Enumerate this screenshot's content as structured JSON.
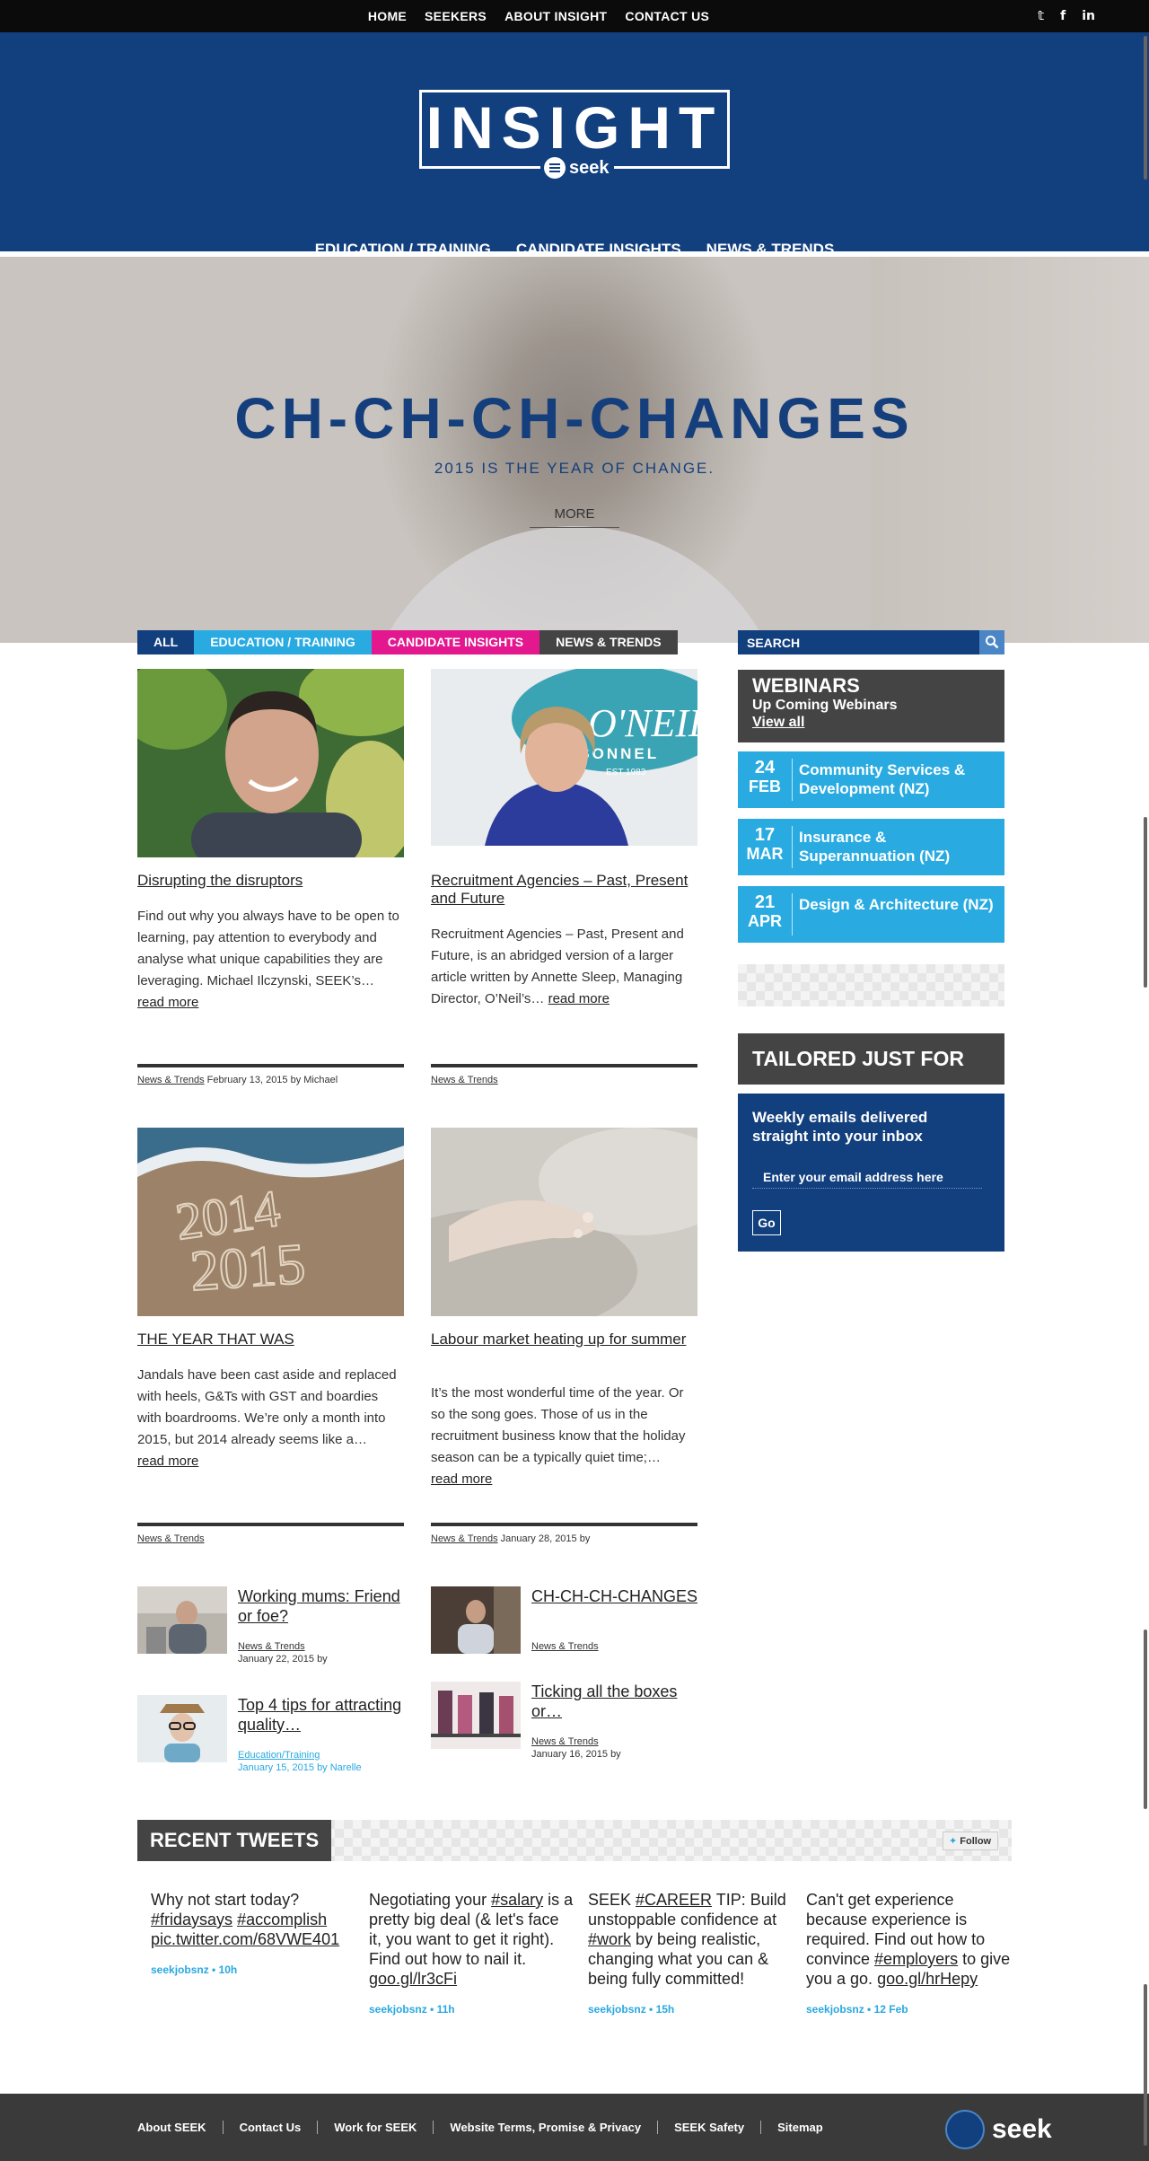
{
  "top_nav": [
    "HOME",
    "SEEKERS",
    "ABOUT INSIGHT",
    "CONTACT US"
  ],
  "social": [
    "twitter-icon",
    "facebook-icon",
    "linkedin-icon"
  ],
  "social_glyphs": [
    "𝕥",
    "f",
    "in"
  ],
  "logo": {
    "title": "INSIGHT",
    "brand": "seek"
  },
  "main_nav": [
    "EDUCATION / TRAINING",
    "CANDIDATE INSIGHTS",
    "NEWS & TRENDS"
  ],
  "hero": {
    "title": "CH-CH-CH-CHANGES",
    "subtitle": "2015 IS THE YEAR OF CHANGE.",
    "more": "MORE"
  },
  "filter_tabs": [
    {
      "label": "ALL",
      "color": "#123f7d"
    },
    {
      "label": "EDUCATION / TRAINING",
      "color": "#29abe2"
    },
    {
      "label": "CANDIDATE INSIGHTS",
      "color": "#e3178e"
    },
    {
      "label": "NEWS & TRENDS",
      "color": "#444444"
    }
  ],
  "search": {
    "placeholder": "SEARCH"
  },
  "articles": [
    {
      "title": "Disrupting the disruptors",
      "excerpt": "Find out why you always have to be open to learning, pay attention to everybody and analyse what unique capabilities they are leveraging. Michael Ilczynski, SEEK’s…",
      "read_more": "read more",
      "category": "News & Trends",
      "meta": " February 13, 2015 by Michael"
    },
    {
      "title": "Recruitment Agencies – Past, Present and Future",
      "excerpt": "Recruitment Agencies – Past, Present and Future, is an abridged version of a larger article written by Annette Sleep, Managing Director, O’Neil’s…",
      "read_more": "read more",
      "category": "News & Trends",
      "meta": ""
    },
    {
      "title": "THE YEAR THAT WAS",
      "excerpt": "Jandals have been cast aside and replaced with heels, G&Ts with GST and boardies with boardrooms. We’re only a month into 2015, but 2014 already seems like a…",
      "read_more": "read more",
      "category": "News & Trends",
      "meta": ""
    },
    {
      "title": "Labour market heating up for summer",
      "excerpt": "It’s the most wonderful time of the year. Or so the song goes. Those of us in the recruitment business know that the holiday season can be a typically quiet time;…",
      "read_more": "read more",
      "category": "News & Trends",
      "meta": " January 28, 2015 by"
    }
  ],
  "oneils_sign": {
    "line1": "O'NEILS",
    "line2": "RSONNEL",
    "line3": "EST 1983"
  },
  "sand_text": {
    "line1": "2014",
    "line2": "2015"
  },
  "mini_posts": [
    {
      "title": "Working mums: Friend or foe?",
      "category": "News & Trends",
      "date": "January 22, 2015 by"
    },
    {
      "title": "CH-CH-CH-CHANGES",
      "category": "News & Trends",
      "date": ""
    },
    {
      "title": "Top 4 tips for attracting quality…",
      "category": "Education/Training",
      "date": "January 15, 2015 by Narelle"
    },
    {
      "title": "Ticking all the boxes or…",
      "category": "News & Trends",
      "date": "January 16, 2015 by"
    }
  ],
  "webinars": {
    "heading": "WEBINARS",
    "subheading": "Up Coming Webinars",
    "view_all": "View all",
    "items": [
      {
        "day": "24",
        "month": "FEB",
        "name": "Community Services & Development (NZ)"
      },
      {
        "day": "17",
        "month": "MAR",
        "name": "Insurance & Superannuation (NZ)"
      },
      {
        "day": "21",
        "month": "APR",
        "name": "Design & Architecture (NZ)"
      }
    ]
  },
  "tailored": {
    "heading": "TAILORED JUST FOR YOU",
    "text": "Weekly emails delivered straight into your inbox",
    "placeholder": "Enter your email address here",
    "button": "Go"
  },
  "tweets": {
    "heading": "RECENT TWEETS",
    "follow": "Follow",
    "items": [
      {
        "parts": [
          {
            "t": "Why not start today? "
          },
          {
            "t": "#fridaysays",
            "link": true
          },
          {
            "t": " "
          },
          {
            "t": "#accomplish",
            "link": true
          },
          {
            "t": " "
          },
          {
            "t": "pic.twitter.com/68VWE401",
            "link": true
          }
        ],
        "handle": "seekjobsnz",
        "time": "10h"
      },
      {
        "parts": [
          {
            "t": "Negotiating your "
          },
          {
            "t": "#salary",
            "link": true
          },
          {
            "t": " is a pretty big deal (& let's face it, you want to get it right). Find out how to nail it. "
          },
          {
            "t": "goo.gl/lr3cFi",
            "link": true
          }
        ],
        "handle": "seekjobsnz",
        "time": "11h"
      },
      {
        "parts": [
          {
            "t": "SEEK "
          },
          {
            "t": "#CAREER",
            "link": true
          },
          {
            "t": " TIP: Build unstoppable confidence at "
          },
          {
            "t": "#work",
            "link": true
          },
          {
            "t": " by being realistic, changing what you can & being fully committed!"
          }
        ],
        "handle": "seekjobsnz",
        "time": "15h"
      },
      {
        "parts": [
          {
            "t": "Can't get experience because experience is required. Find out how to convince "
          },
          {
            "t": "#employers",
            "link": true
          },
          {
            "t": " to give you a go. "
          },
          {
            "t": "goo.gl/hrHepy",
            "link": true
          }
        ],
        "handle": "seekjobsnz",
        "time": "12 Feb"
      }
    ]
  },
  "footer": {
    "links": [
      "About SEEK",
      "Contact Us",
      "Work for SEEK",
      "Website Terms, Promise & Privacy",
      "SEEK Safety",
      "Sitemap"
    ],
    "brand": "seek"
  }
}
